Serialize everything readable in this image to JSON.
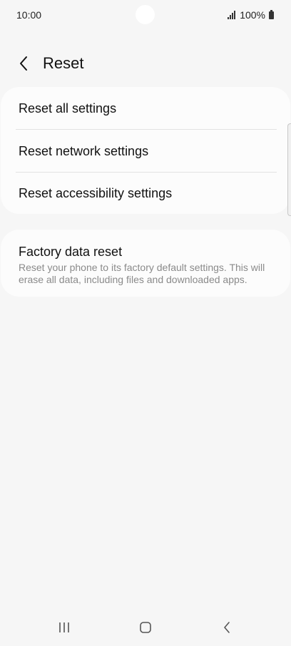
{
  "status_bar": {
    "time": "10:00",
    "battery": "100%",
    "icons": [
      "signal-icon",
      "battery-icon"
    ]
  },
  "header": {
    "title": "Reset",
    "back_icon": "back-arrow-icon"
  },
  "reset_options": [
    {
      "label": "Reset all settings"
    },
    {
      "label": "Reset network settings"
    },
    {
      "label": "Reset accessibility settings"
    }
  ],
  "factory_reset": {
    "title": "Factory data reset",
    "description": "Reset your phone to its factory default settings. This will erase all data, including files and downloaded apps."
  },
  "nav_bar": {
    "icons": [
      "recent-apps-icon",
      "home-icon",
      "back-icon"
    ]
  },
  "colors": {
    "background": "#f6f6f6",
    "card": "#fcfcfc",
    "text_primary": "#111111",
    "text_secondary": "#8a8a8a"
  }
}
